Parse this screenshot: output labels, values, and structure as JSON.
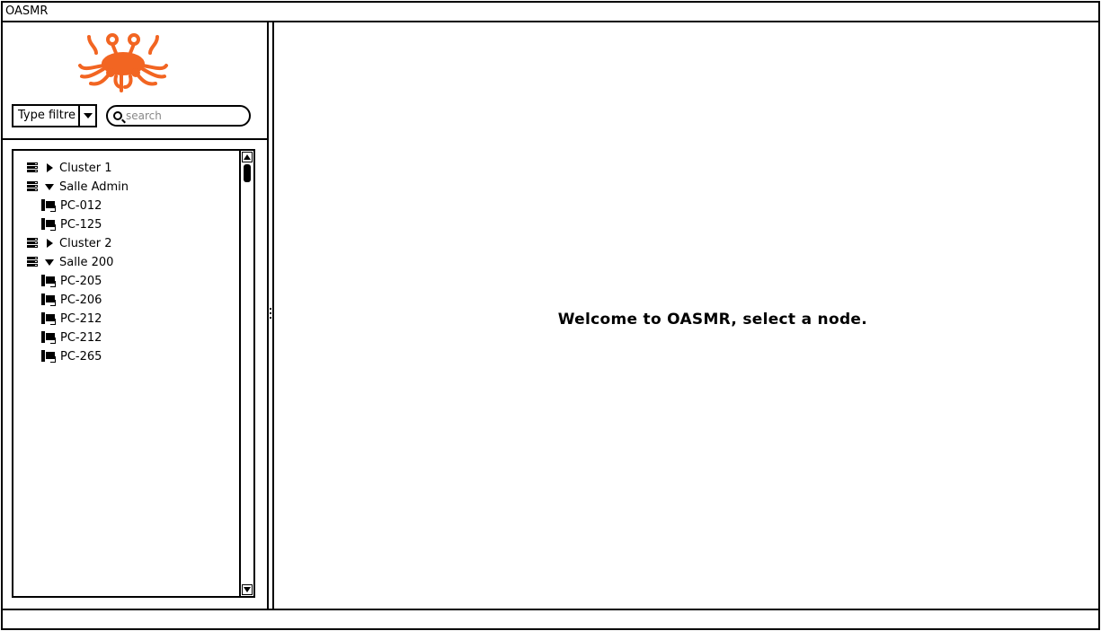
{
  "window": {
    "title": "OASMR"
  },
  "sidebar": {
    "logo": {
      "name": "flying-spaghetti-monster-logo",
      "color": "#f26522"
    },
    "filter": {
      "selected": "Type filtre"
    },
    "search": {
      "placeholder": "search"
    },
    "tree": [
      {
        "label": "Cluster 1",
        "type": "group",
        "expanded": false,
        "depth": 0
      },
      {
        "label": "Salle Admin",
        "type": "group",
        "expanded": true,
        "depth": 0
      },
      {
        "label": "PC-012",
        "type": "pc",
        "depth": 1
      },
      {
        "label": "PC-125",
        "type": "pc",
        "depth": 1
      },
      {
        "label": "Cluster 2",
        "type": "group",
        "expanded": false,
        "depth": 0
      },
      {
        "label": "Salle 200",
        "type": "group",
        "expanded": true,
        "depth": 0
      },
      {
        "label": "PC-205",
        "type": "pc",
        "depth": 1
      },
      {
        "label": "PC-206",
        "type": "pc",
        "depth": 1
      },
      {
        "label": "PC-212",
        "type": "pc",
        "depth": 1
      },
      {
        "label": "PC-212",
        "type": "pc",
        "depth": 1
      },
      {
        "label": "PC-265",
        "type": "pc",
        "depth": 1
      }
    ]
  },
  "main": {
    "welcome": "Welcome to OASMR, select a node."
  },
  "colors": {
    "stroke": "#000000",
    "background": "#ffffff",
    "placeholder": "#888888",
    "logo": "#f26522"
  }
}
